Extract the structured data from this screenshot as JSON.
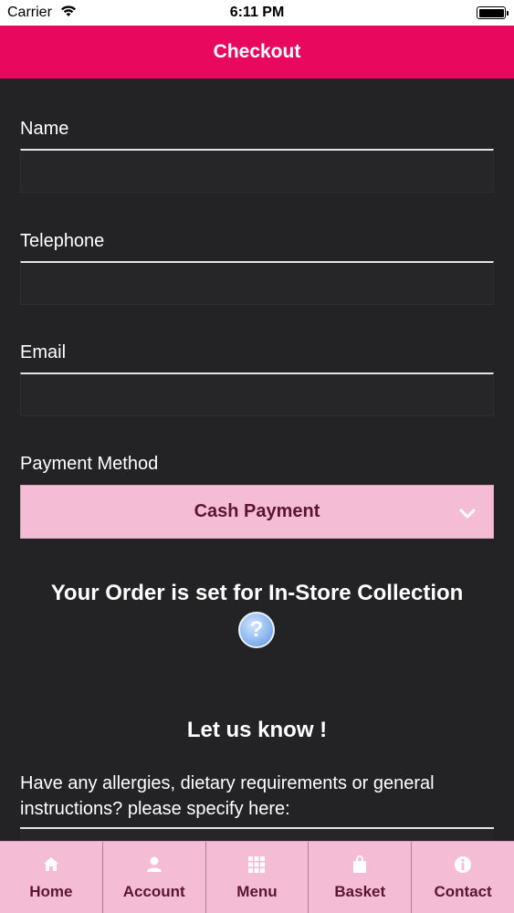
{
  "status_bar": {
    "carrier": "Carrier",
    "time": "6:11 PM"
  },
  "header": {
    "title": "Checkout"
  },
  "form": {
    "name": {
      "label": "Name",
      "value": ""
    },
    "telephone": {
      "label": "Telephone",
      "value": ""
    },
    "email": {
      "label": "Email",
      "value": ""
    },
    "payment": {
      "label": "Payment Method",
      "selected": "Cash Payment"
    }
  },
  "collection_notice": "Your Order is set for In-Store Collection",
  "help_icon_glyph": "?",
  "notes": {
    "heading": "Let us know !",
    "prompt": "Have any allergies, dietary requirements or general instructions? please specify here:"
  },
  "tabs": [
    {
      "label": "Home",
      "icon": "home-icon"
    },
    {
      "label": "Account",
      "icon": "user-icon"
    },
    {
      "label": "Menu",
      "icon": "grid-icon"
    },
    {
      "label": "Basket",
      "icon": "bag-icon"
    },
    {
      "label": "Contact",
      "icon": "info-icon"
    }
  ],
  "colors": {
    "accent": "#e8095f",
    "background": "#232224",
    "tab_bg": "#f5bcd6",
    "tab_text": "#5a1531"
  }
}
